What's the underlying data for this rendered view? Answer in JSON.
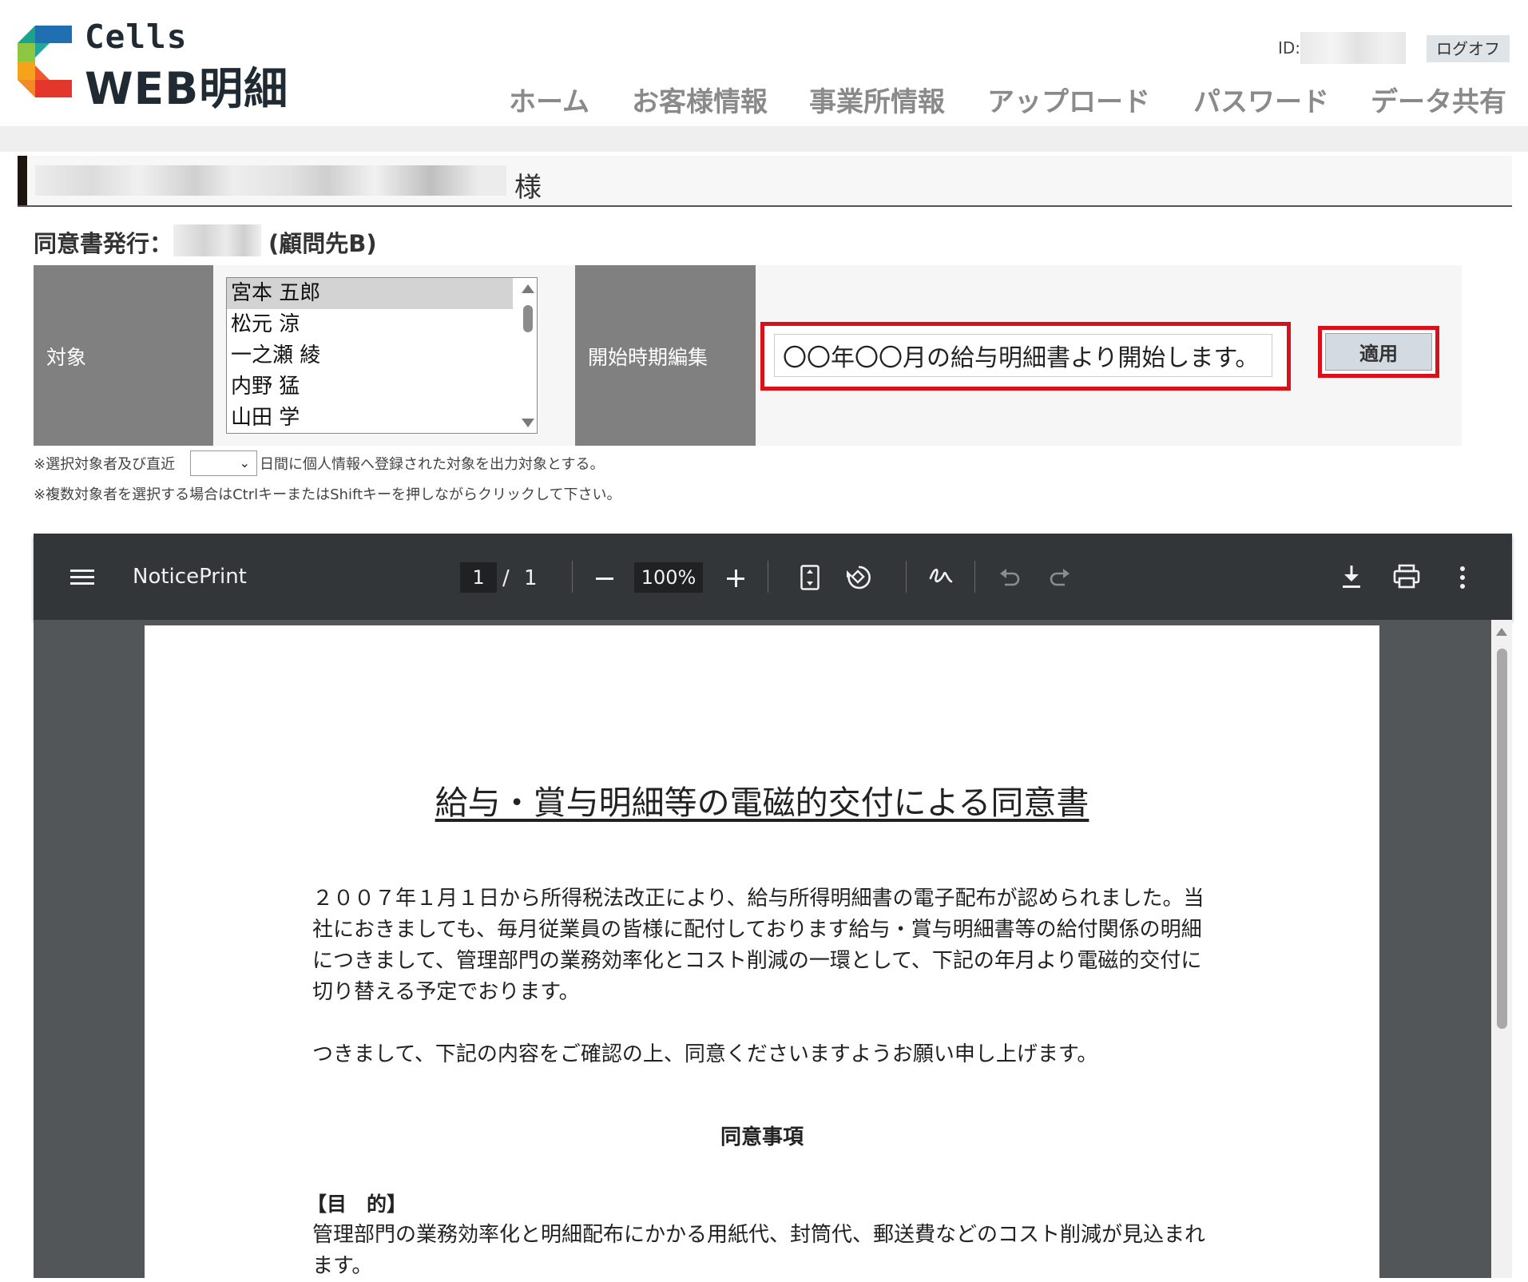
{
  "header": {
    "logo_cells": "Cells",
    "logo_web": "WEB明細",
    "id_label": "ID:",
    "logoff_label": "ログオフ",
    "nav": [
      "ホーム",
      "お客様情報",
      "事業所情報",
      "アップロード",
      "パスワード",
      "データ共有"
    ]
  },
  "customer": {
    "suffix": "様"
  },
  "consent": {
    "title_prefix": "同意書発行：",
    "client": "(顧問先B)",
    "target_label": "対象",
    "employees": [
      "宮本 五郎",
      "松元 涼",
      "一之瀬 綾",
      "内野 猛",
      "山田 学"
    ],
    "selected_employee": "宮本 五郎",
    "start_label": "開始時期編集",
    "start_text": "〇〇年〇〇月の給与明細書より開始します。",
    "apply_label": "適用",
    "note1_before": "※選択対象者及び直近",
    "note1_after": "日間に個人情報へ登録された対象を出力対象とする。",
    "note2": "※複数対象者を選択する場合はCtrlキーまたはShiftキーを押しながらクリックして下さい。"
  },
  "pdf_viewer": {
    "title": "NoticePrint",
    "page_current": "1",
    "page_sep": "/",
    "page_total": "1",
    "zoom": "100%",
    "icons": [
      "menu-icon",
      "zoom-out-icon",
      "zoom-in-icon",
      "fit-page-icon",
      "rotate-icon",
      "annotate-icon",
      "undo-icon",
      "redo-icon",
      "download-icon",
      "print-icon",
      "more-icon"
    ]
  },
  "document": {
    "title": "給与・賞与明細等の電磁的交付による同意書",
    "para1": "２００７年１月１日から所得税法改正により、給与所得明細書の電子配布が認められました。当社におきましても、毎月従業員の皆様に配付しております給与・賞与明細書等の給付関係の明細につきまして、管理部門の業務効率化とコスト削減の一環として、下記の年月より電磁的交付に切り替える予定でおります。",
    "para2": "つきまして、下記の内容をご確認の上、同意くださいますようお願い申し上げます。",
    "section_heading": "同意事項",
    "purpose_heading": "【目　的】",
    "purpose_text": "管理部門の業務効率化と明細配布にかかる用紙代、封筒代、郵送費などのコスト削減が見込まれます。"
  },
  "colors": {
    "highlight_red": "#d8121b",
    "label_gray": "#808080",
    "viewer_toolbar": "#323639",
    "viewer_bg": "#525659"
  }
}
